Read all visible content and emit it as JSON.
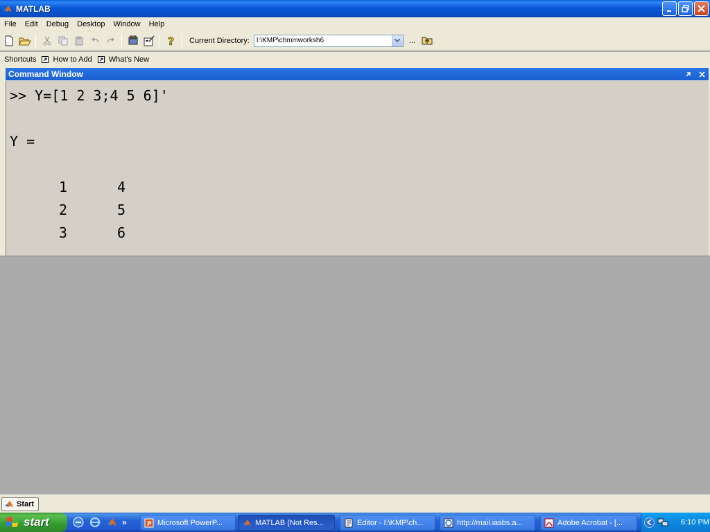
{
  "window": {
    "title": "MATLAB"
  },
  "menu": [
    "File",
    "Edit",
    "Debug",
    "Desktop",
    "Window",
    "Help"
  ],
  "toolbar": {
    "current_directory_label": "Current Directory:",
    "current_directory_value": "I:\\KMP\\chmmworksh6",
    "browse_label": "..."
  },
  "shortcuts": {
    "label": "Shortcuts",
    "items": [
      "How to Add",
      "What's New"
    ]
  },
  "command_window": {
    "title": "Command Window",
    "lines": [
      ">> Y=[1 2 3;4 5 6]'",
      "Y =",
      "1",
      "4",
      "2",
      "5",
      "3",
      "6"
    ]
  },
  "start_strip": {
    "label": "Start"
  },
  "taskbar": {
    "start_label": "start",
    "tasks": [
      "Microsoft PowerP...",
      "MATLAB (Not Res...",
      "Editor - I:\\KMP\\ch...",
      "http://mail.iasbs.a...",
      "Adobe Acrobat - [..."
    ],
    "active_task_index": 1,
    "clock": "6:10 PM"
  },
  "colors": {
    "titlebar": "#0a58d6",
    "command_title": "#1a5fd2",
    "workspace": "#ababab",
    "taskbar": "#2157d0",
    "start_button": "#369a32"
  }
}
